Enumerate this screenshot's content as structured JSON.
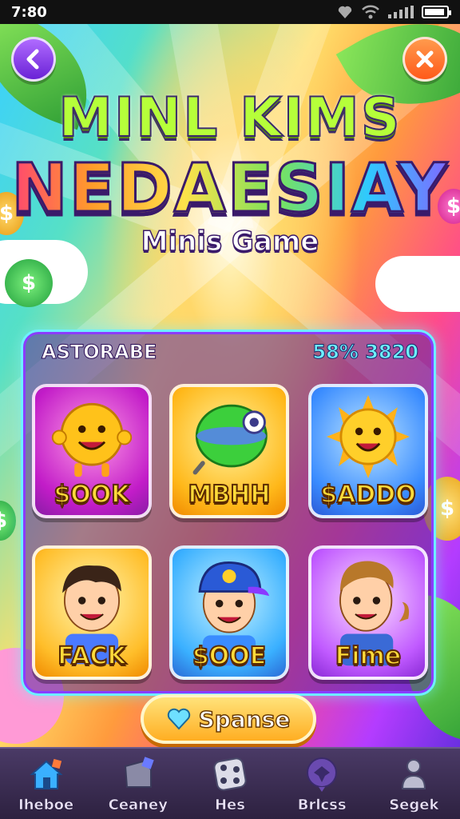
{
  "status_bar": {
    "time": "7:80"
  },
  "header": {
    "title_line1": "MINL KIMS",
    "title_line2": "NEDAESIAY",
    "subtitle": "Minis Game"
  },
  "panel": {
    "label": "ASTORABE",
    "score": "58% 3820"
  },
  "cards": [
    {
      "label": "$OOK",
      "icon": "smiley-ball-icon"
    },
    {
      "label": "MBHH",
      "icon": "green-orb-icon"
    },
    {
      "label": "$ADDO",
      "icon": "sun-face-icon"
    },
    {
      "label": "FACK",
      "icon": "boy-avatar-icon"
    },
    {
      "label": "$OOE",
      "icon": "cap-boy-avatar-icon"
    },
    {
      "label": "Fime",
      "icon": "man-avatar-icon"
    }
  ],
  "action_button": {
    "label": "Spanse",
    "icon": "heart-icon"
  },
  "bottom_nav": [
    {
      "label": "Iheboe",
      "icon": "home-icon"
    },
    {
      "label": "Ceaney",
      "icon": "box-icon"
    },
    {
      "label": "Hes",
      "icon": "dice-icon"
    },
    {
      "label": "Brlcss",
      "icon": "bird-badge-icon"
    },
    {
      "label": "Segek",
      "icon": "person-icon"
    }
  ],
  "colors": {
    "panel_border": "#6ef0ff",
    "card_label": "#ffdb3a",
    "action_button": "#ffae22",
    "nav_bg": "#3a2d52"
  }
}
